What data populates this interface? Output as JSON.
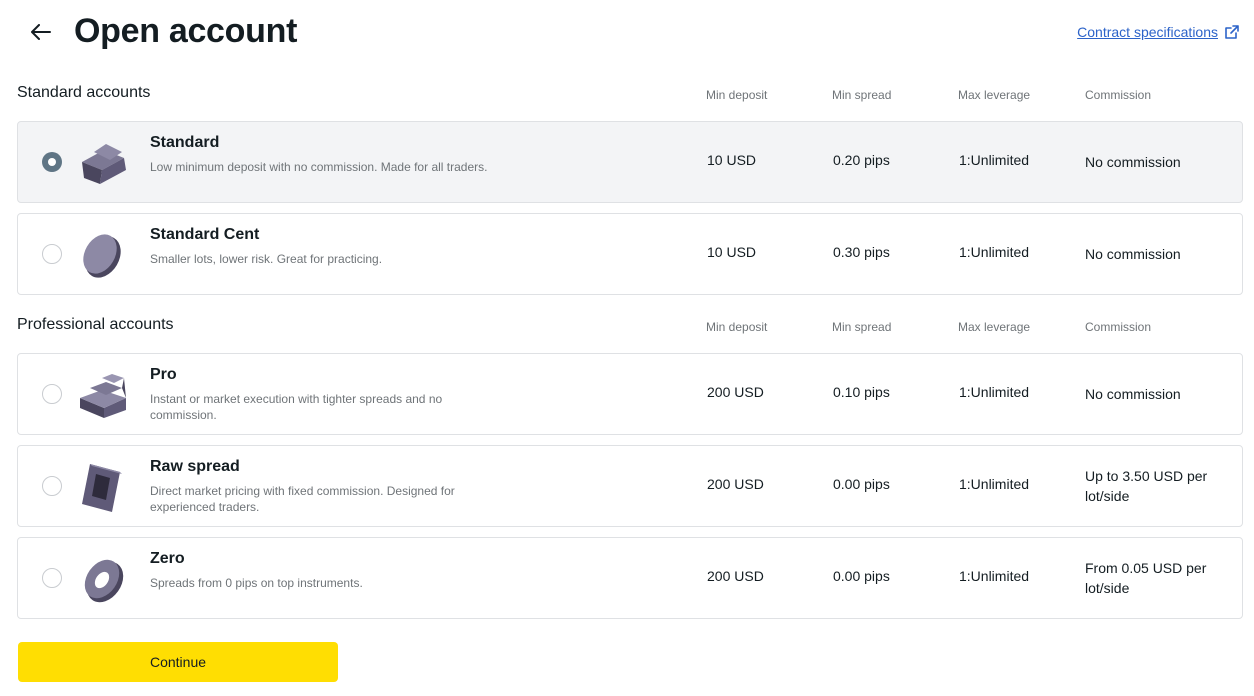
{
  "header": {
    "title": "Open account",
    "back_icon": "arrow-left-icon",
    "contract_link": "Contract specifications",
    "contract_icon": "external-link-icon"
  },
  "columns": {
    "min_deposit": "Min deposit",
    "min_spread": "Min spread",
    "max_leverage": "Max leverage",
    "commission": "Commission"
  },
  "sections": {
    "standard": "Standard accounts",
    "professional": "Professional accounts"
  },
  "accounts": [
    {
      "name": "Standard",
      "description": "Low minimum deposit with no commission. Made for all traders.",
      "min_deposit": "10 USD",
      "min_spread": "0.20 pips",
      "max_leverage": "1:Unlimited",
      "commission": "No commission",
      "selected": true,
      "icon": "wedge-icon"
    },
    {
      "name": "Standard Cent",
      "description": "Smaller lots, lower risk. Great for practicing.",
      "min_deposit": "10 USD",
      "min_spread": "0.30 pips",
      "max_leverage": "1:Unlimited",
      "commission": "No commission",
      "selected": false,
      "icon": "disc-icon"
    },
    {
      "name": "Pro",
      "description": "Instant or market execution with tighter spreads and no commission.",
      "min_deposit": "200 USD",
      "min_spread": "0.10 pips",
      "max_leverage": "1:Unlimited",
      "commission": "No commission",
      "selected": false,
      "icon": "stairs-icon"
    },
    {
      "name": "Raw spread",
      "description": "Direct market pricing with fixed commission. Designed for experienced traders.",
      "min_deposit": "200 USD",
      "min_spread": "0.00 pips",
      "max_leverage": "1:Unlimited",
      "commission": "Up to 3.50 USD per lot/side",
      "selected": false,
      "icon": "frame-icon"
    },
    {
      "name": "Zero",
      "description": "Spreads from 0 pips on top instruments.",
      "min_deposit": "200 USD",
      "min_spread": "0.00 pips",
      "max_leverage": "1:Unlimited",
      "commission": "From 0.05 USD per lot/side",
      "selected": false,
      "icon": "ring-icon"
    }
  ],
  "continue_label": "Continue",
  "colors": {
    "accent_yellow": "#ffde02",
    "link_blue": "#2c63c9",
    "selected_bg": "#f3f4f6",
    "radio_selected": "#5f7585",
    "icon_purple": "#5a5670"
  }
}
